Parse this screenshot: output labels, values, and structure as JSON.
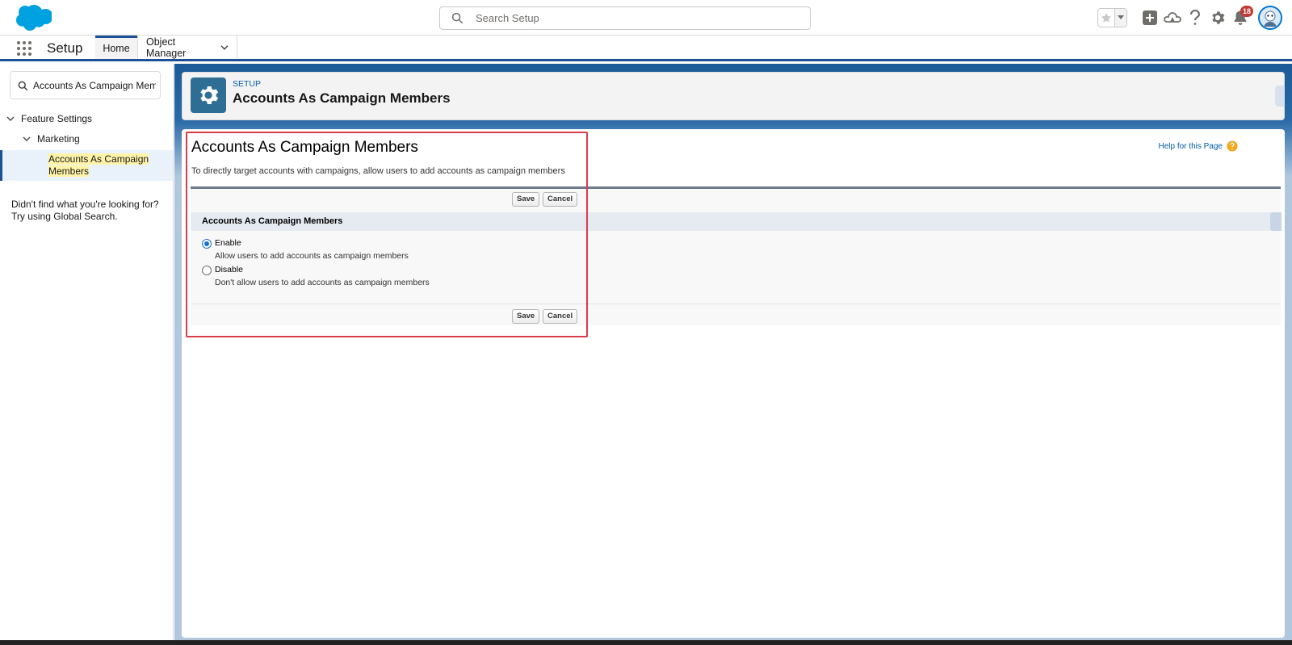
{
  "header": {
    "search_placeholder": "Search Setup",
    "notification_count": "18"
  },
  "context_bar": {
    "app_name": "Setup",
    "tabs": [
      {
        "label": "Home"
      },
      {
        "label": "Object Manager"
      }
    ]
  },
  "sidebar": {
    "quickfind_value": "Accounts As Campaign Mem",
    "tree": {
      "level1": "Feature Settings",
      "level2": "Marketing",
      "leaf": "Accounts As Campaign Members"
    },
    "not_found_line1": "Didn't find what you're looking for?",
    "not_found_line2": "Try using Global Search."
  },
  "page_header": {
    "eyebrow": "SETUP",
    "title": "Accounts As Campaign Members"
  },
  "content": {
    "title": "Accounts As Campaign Members",
    "help_link": "Help for this Page",
    "description": "To directly target accounts with campaigns, allow users to add accounts as campaign members",
    "save_label": "Save",
    "cancel_label": "Cancel",
    "section_title": "Accounts As Campaign Members",
    "options": [
      {
        "label": "Enable",
        "description": "Allow users to add accounts as campaign members",
        "checked": true
      },
      {
        "label": "Disable",
        "description": "Don't allow users to add accounts as campaign members",
        "checked": false
      }
    ]
  },
  "colors": {
    "brand": "#1b5297",
    "highlight_box": "#d93d4a",
    "setup_icon_bg": "#2e6d94"
  }
}
